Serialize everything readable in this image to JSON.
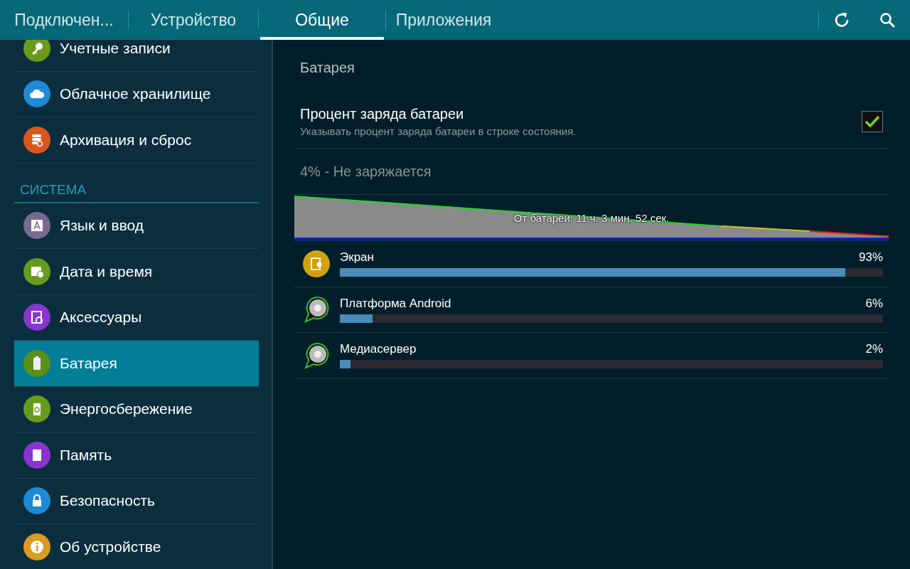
{
  "tabs": [
    {
      "label": "Подключен...",
      "selected": false
    },
    {
      "label": "Устройство",
      "selected": false
    },
    {
      "label": "Общие",
      "selected": true
    },
    {
      "label": "Приложения",
      "selected": false
    }
  ],
  "sidebar": {
    "items": [
      {
        "label": "Учетные записи",
        "color": "#6a9a1c",
        "selected": false
      },
      {
        "label": "Облачное хранилище",
        "color": "#1e8ad6",
        "selected": false
      },
      {
        "label": "Архивация и сброс",
        "color": "#d9571c",
        "selected": false
      }
    ],
    "section": "СИСТЕМА",
    "system_items": [
      {
        "label": "Язык и ввод",
        "color": "#786a8e",
        "selected": false
      },
      {
        "label": "Дата и время",
        "color": "#6a9a1c",
        "selected": false
      },
      {
        "label": "Аксессуары",
        "color": "#8a35d0",
        "selected": false
      },
      {
        "label": "Батарея",
        "color": "#5e8e1a",
        "selected": true
      },
      {
        "label": "Энергосбережение",
        "color": "#6a9a1c",
        "selected": false
      },
      {
        "label": "Память",
        "color": "#8a35d0",
        "selected": false
      },
      {
        "label": "Безопасность",
        "color": "#1e8ad6",
        "selected": false
      },
      {
        "label": "Об устройстве",
        "color": "#dc9a1e",
        "selected": false
      }
    ]
  },
  "panel": {
    "title": "Батарея",
    "setting": {
      "title": "Процент заряда батареи",
      "description": "Указывать процент заряда батареи в строке состояния.",
      "checked": true
    },
    "status": "4% - Не заряжается",
    "graph_label": "От батареи: 11 ч. 3 мин. 52 сек.",
    "usage": [
      {
        "name": "Экран",
        "reading": "93%",
        "level": 0.93,
        "kind": "screen"
      },
      {
        "name": "Платформа Android",
        "reading": "6%",
        "level": 0.06,
        "kind": "app"
      },
      {
        "name": "Медиасервер",
        "reading": "2%",
        "level": 0.02,
        "kind": "app"
      }
    ]
  }
}
